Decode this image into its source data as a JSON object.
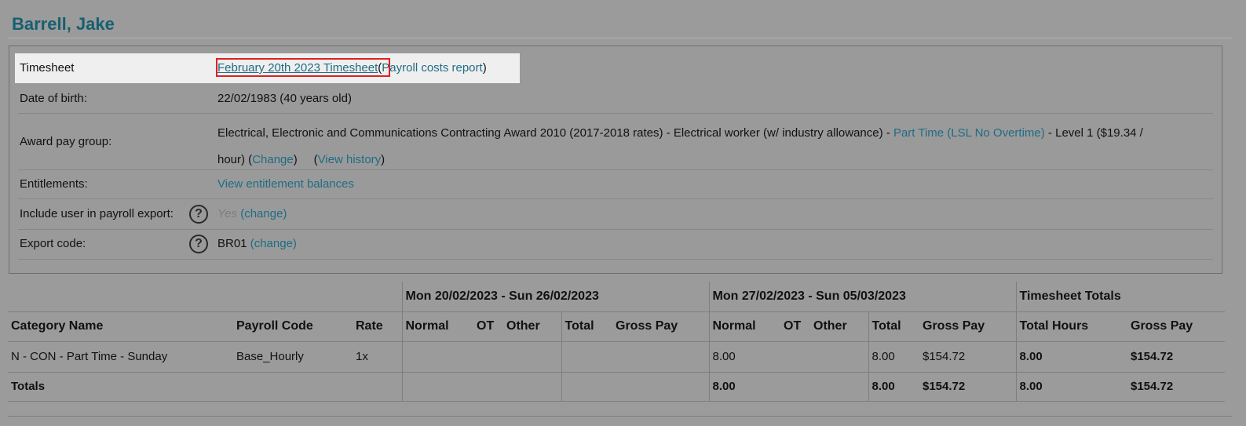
{
  "employee": {
    "name": "Barrell, Jake"
  },
  "info": {
    "timesheet": {
      "label": "Timesheet",
      "link": "February 20th 2023 Timesheet",
      "open_paren": "(",
      "report_link": "Payroll costs report",
      "close_paren": ")"
    },
    "dob": {
      "label": "Date of birth:",
      "value": "22/02/1983 (40 years old)"
    },
    "award": {
      "label": "Award pay group:",
      "text_a": "Electrical, Electronic and Communications Contracting Award 2010 (2017-2018 rates) - Electrical worker (w/ industry allowance) - ",
      "part_time_link": "Part Time (LSL No Overtime)",
      "text_b": " - Level 1 ($19.34 /",
      "text_c": "hour) (",
      "change_link": "Change",
      "text_d": ")",
      "text_e": "(",
      "history_link": "View history",
      "text_f": ")"
    },
    "entitlements": {
      "label": "Entitlements:",
      "link": "View entitlement balances"
    },
    "payroll_export": {
      "label": "Include user in payroll export:",
      "help": "?",
      "value": "Yes",
      "change_link": "(change)"
    },
    "export_code": {
      "label": "Export code:",
      "help": "?",
      "value": "BR01",
      "change_link": "(change)"
    }
  },
  "table": {
    "group_headers": [
      "Mon 20/02/2023 - Sun 26/02/2023",
      "Mon 27/02/2023 - Sun 05/03/2023",
      "Timesheet Totals"
    ],
    "columns": {
      "category": "Category Name",
      "payroll_code": "Payroll Code",
      "rate": "Rate",
      "normal": "Normal",
      "ot": "OT",
      "other": "Other",
      "total": "Total",
      "gross_pay": "Gross Pay",
      "total_hours": "Total Hours"
    },
    "row": {
      "category": "N - CON - Part Time - Sunday",
      "payroll_code": "Base_Hourly",
      "rate": "1x",
      "w1": {
        "normal": "",
        "ot": "",
        "other": "",
        "total": "",
        "gross": ""
      },
      "w2": {
        "normal": "8.00",
        "ot": "",
        "other": "",
        "total": "8.00",
        "gross": "$154.72"
      },
      "totals": {
        "hours": "8.00",
        "gross": "$154.72"
      }
    },
    "totals_row": {
      "label": "Totals",
      "w1": {
        "normal": "",
        "total": "",
        "gross": ""
      },
      "w2": {
        "normal": "8.00",
        "total": "8.00",
        "gross": "$154.72"
      },
      "totals": {
        "hours": "8.00",
        "gross": "$154.72"
      }
    }
  }
}
